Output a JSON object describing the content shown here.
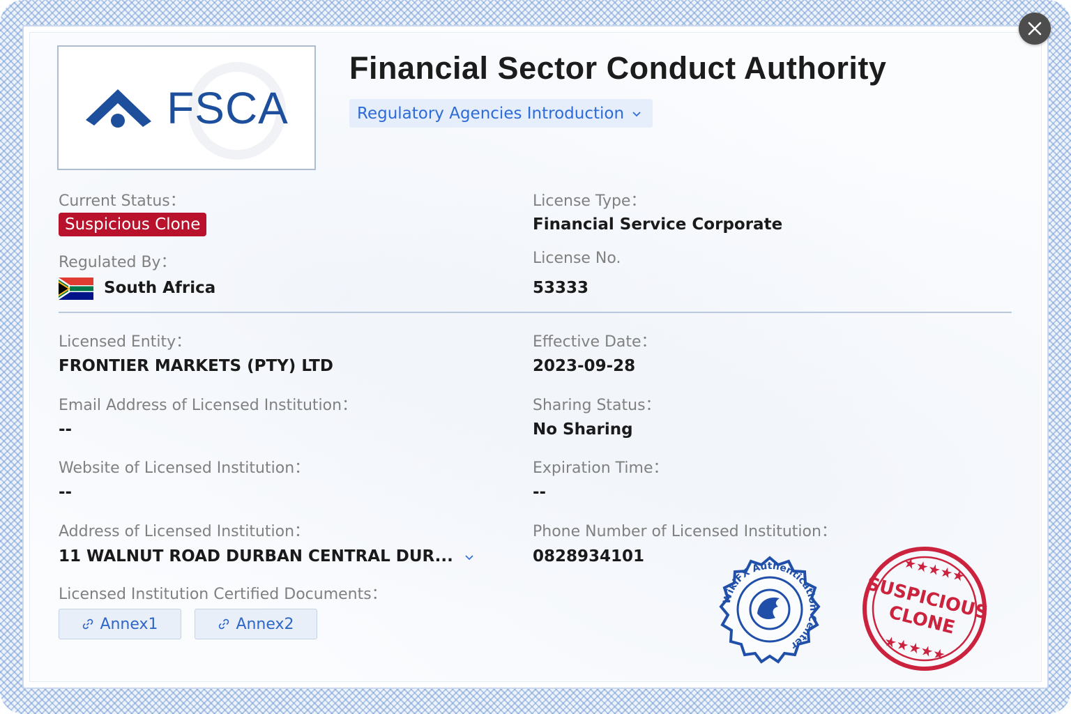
{
  "close": {
    "icon": "close-icon"
  },
  "logo": {
    "text": "FSCA",
    "icon": "fsca-roof-icon"
  },
  "header": {
    "title": "Financial Sector Conduct Authority",
    "agency_dropdown": "Regulatory Agencies Introduction"
  },
  "fields": {
    "current_status_label": "Current Status：",
    "current_status_value": "Suspicious Clone",
    "license_type_label": "License Type：",
    "license_type_value": "Financial Service Corporate",
    "regulated_by_label": "Regulated By：",
    "regulated_by_value": "South Africa",
    "license_no_label": "License No.",
    "license_no_value": "53333",
    "licensed_entity_label": "Licensed Entity：",
    "licensed_entity_value": "FRONTIER MARKETS (PTY) LTD",
    "effective_date_label": "Effective Date：",
    "effective_date_value": "2023-09-28",
    "email_label": "Email Address of Licensed Institution：",
    "email_value": "--",
    "sharing_status_label": "Sharing Status：",
    "sharing_status_value": "No Sharing",
    "website_label": "Website of Licensed Institution：",
    "website_value": "--",
    "expiration_label": "Expiration Time：",
    "expiration_value": "--",
    "address_label": "Address of Licensed Institution：",
    "address_value": "11 WALNUT ROAD DURBAN CENTRAL DUR...",
    "phone_label": "Phone Number of Licensed Institution：",
    "phone_value": "0828934101",
    "documents_label": "Licensed Institution Certified Documents："
  },
  "documents": [
    {
      "label": "Annex1"
    },
    {
      "label": "Annex2"
    }
  ],
  "stamps": {
    "blue_text": "WikiFX Authentication Center",
    "red_text": "SUSPICIOUS CLONE"
  },
  "colors": {
    "badge_red": "#b8122c",
    "link_blue": "#2c6bd8",
    "brand_blue": "#1d4f9c",
    "stamp_red": "#c8102e",
    "stamp_blue": "#1f4fa8"
  }
}
